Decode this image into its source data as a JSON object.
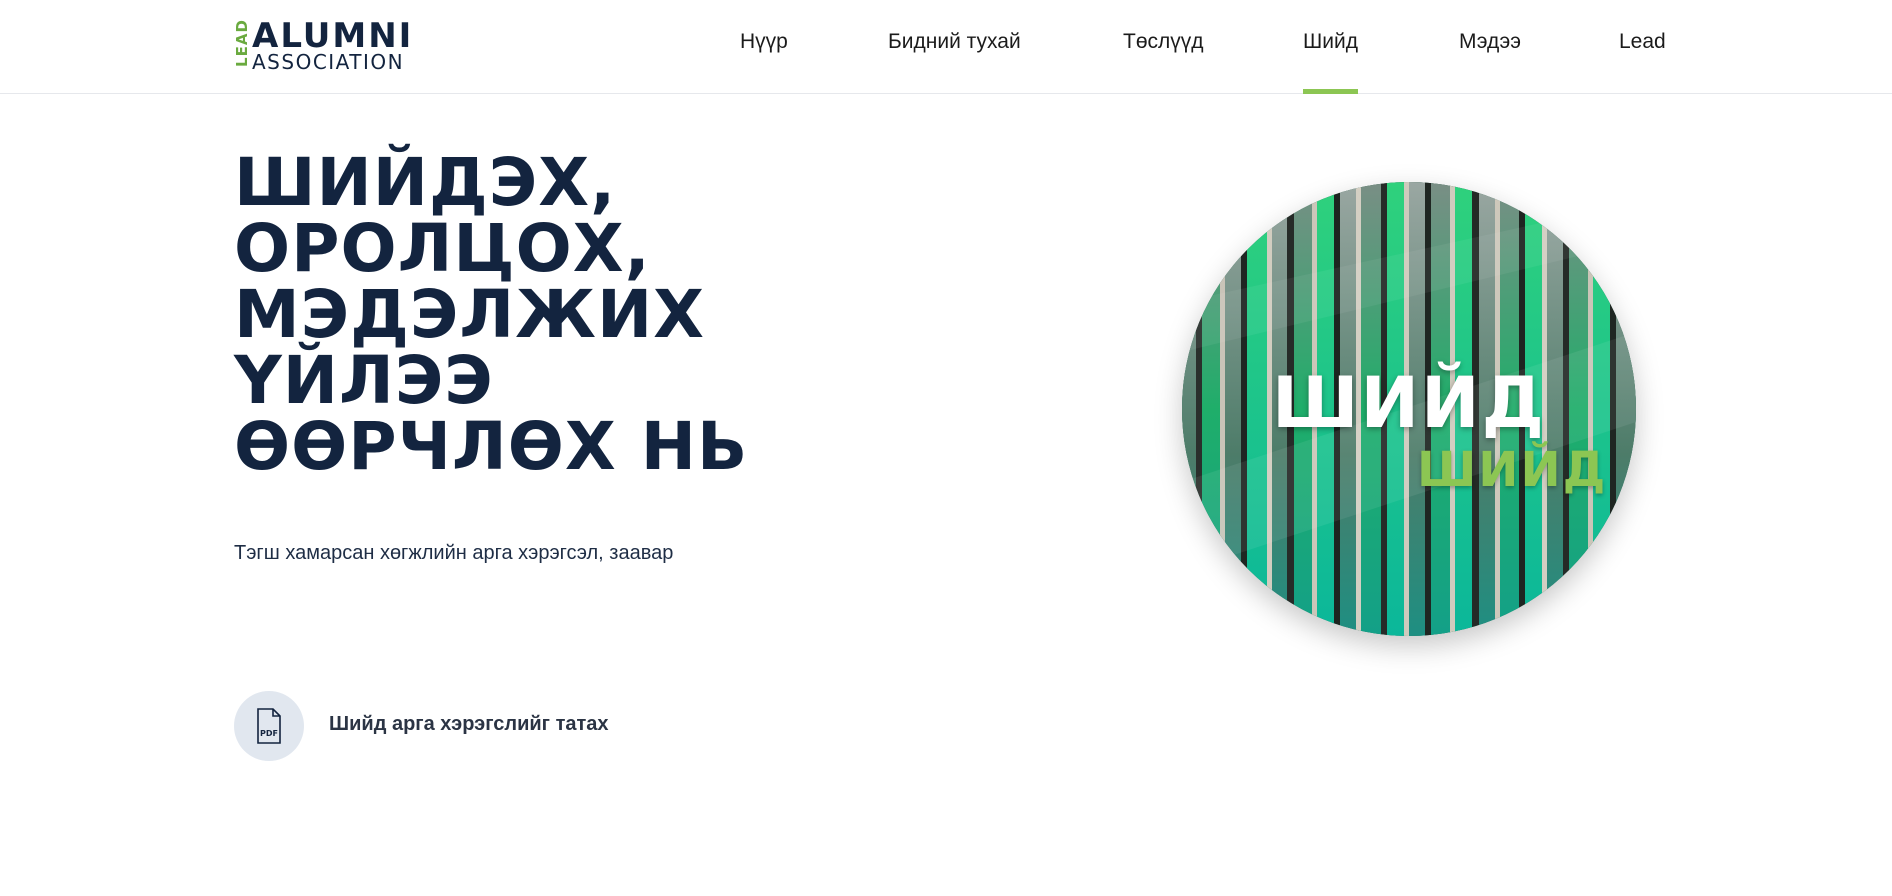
{
  "logo": {
    "side_text": "LEAD",
    "main_text": "ALUMNI",
    "sub_text": "ASSOCIATION"
  },
  "nav": {
    "items": [
      {
        "label": "Нүүр",
        "active": false
      },
      {
        "label": "Бидний тухай",
        "active": false
      },
      {
        "label": "Төслүүд",
        "active": false
      },
      {
        "label": "Шийд",
        "active": true
      },
      {
        "label": "Мэдээ",
        "active": false
      },
      {
        "label": "Lead",
        "active": false
      }
    ],
    "active_color": "#8cc653"
  },
  "hero": {
    "title_lines": [
      "ШИЙДЭХ,",
      "ОРОЛЦОХ,",
      "МЭДЭЛЖИХ",
      "ҮЙЛЭЭ",
      "ӨӨРЧЛӨХ НЬ"
    ],
    "subtitle": "Тэгш хамарсан хөгжлийн арга хэрэгсэл, заавар",
    "title_color": "#13243f"
  },
  "download": {
    "icon": "pdf-icon",
    "icon_text": "PDF",
    "label": "Шийд арга хэрэгслийг татах"
  },
  "feature_image": {
    "text_primary": "ШИЙД",
    "text_secondary": "ШИЙД",
    "accent_color": "#8cc653"
  }
}
